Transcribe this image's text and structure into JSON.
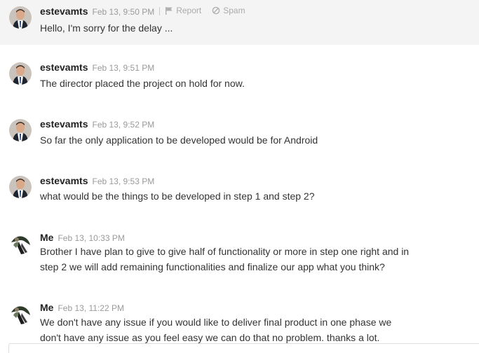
{
  "messages": [
    {
      "author": "estevamts",
      "time": "Feb 13, 9:50 PM",
      "text": "Hello, I'm sorry for the delay ...",
      "avatar": "estevamts-avatar",
      "report_label": "Report",
      "spam_label": "Spam"
    },
    {
      "author": "estevamts",
      "time": "Feb 13, 9:51 PM",
      "text": "The director placed the project on hold for now.",
      "avatar": "estevamts-avatar"
    },
    {
      "author": "estevamts",
      "time": "Feb 13, 9:52 PM",
      "text": "So far the only application to be developed would be for Android",
      "avatar": "estevamts-avatar"
    },
    {
      "author": "estevamts",
      "time": "Feb 13, 9:53 PM",
      "text": "what would be the things to be developed in step 1 and step 2?",
      "avatar": "estevamts-avatar"
    },
    {
      "author": "Me",
      "time": "Feb 13, 10:33 PM",
      "text": "Brother I have plan to give to give half of functionality or more in step one right and in step 2 we will add remaining functionalities and finalize our app what you think?",
      "avatar": "me-avatar"
    },
    {
      "author": "Me",
      "time": "Feb 13, 11:22 PM",
      "text": "We don't have any issue if you would like to deliver final product in one phase we don't have any issue as you feel easy we can do that no problem. thanks a lot.",
      "avatar": "me-avatar"
    }
  ],
  "icons": {
    "report": "flag-icon",
    "spam": "ban-icon"
  },
  "colors": {
    "highlight_background": "#f4f4f4",
    "author": "#222222",
    "timestamp": "#9a9a9a",
    "body_text": "#333333",
    "action_text": "#aaaaaa"
  }
}
